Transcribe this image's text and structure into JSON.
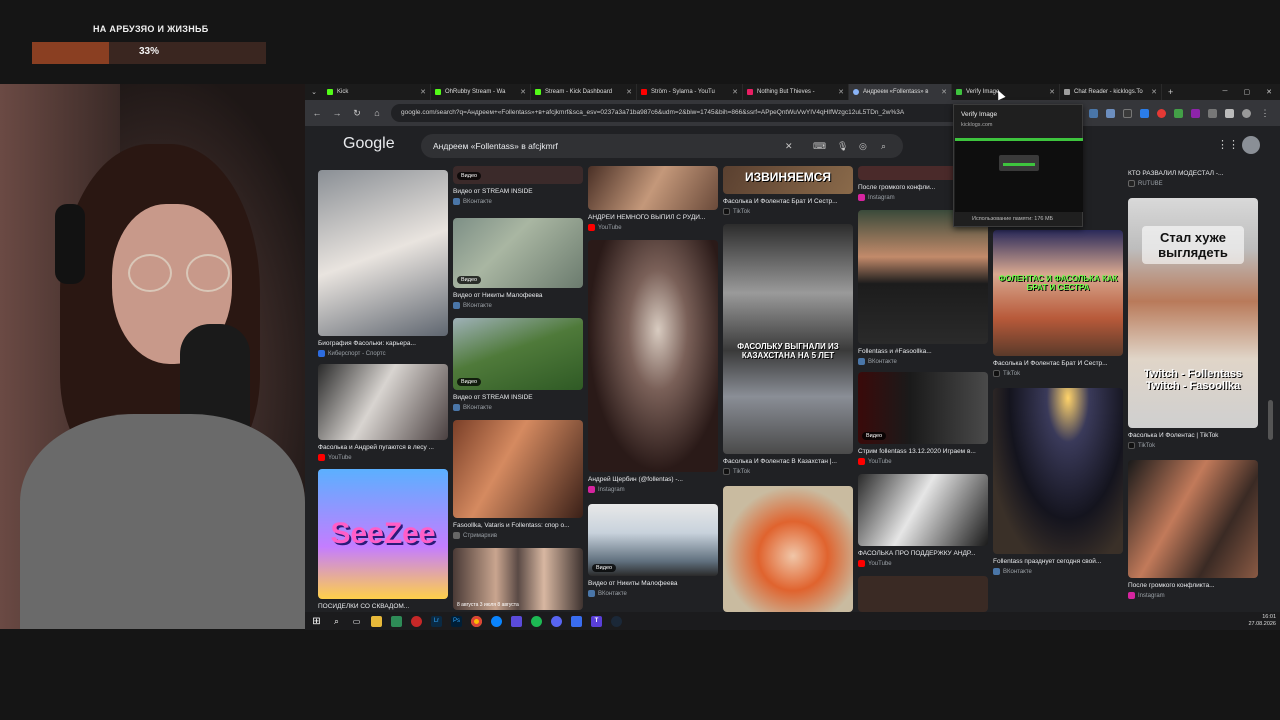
{
  "overlay": {
    "goal_title": "НА АРБУЗЯО И ЖИЗНЬБ",
    "goal_percent_text": "33%",
    "goal_progress": 0.33
  },
  "browser": {
    "tabs": [
      {
        "label": "Kick",
        "color": "#53fc18"
      },
      {
        "label": "OhRubby Stream - Wa",
        "color": "#53fc18"
      },
      {
        "label": "Stream - Kick Dashboard",
        "color": "#53fc18"
      },
      {
        "label": "Ström - Sylarna - YouTu",
        "color": "#ff0000"
      },
      {
        "label": "Nothing But Thieves -",
        "color": "#e91e63"
      },
      {
        "label": "Андреем «Follentass» в",
        "color": "#8ab4f8",
        "active": true
      },
      {
        "label": "Verify Image",
        "color": "#3ec43e"
      },
      {
        "label": "Chat Reader - kicklogs.To",
        "color": "#9e9e9e"
      }
    ],
    "url": "google.com/search?q=Андреем+«Follentass»+в+afcjkmrf&sca_esv=0237a3a71ba987c6&udm=2&biw=1745&bih=866&ssrf=APpeQntWuVwYIV4qHIfWzgc12uL5TDn_2w%3A",
    "popup": {
      "title": "Verify Image",
      "domain": "kicklogs.com",
      "memory": "Использование памяти: 176 МБ"
    }
  },
  "google": {
    "logo": "Google",
    "query": "Андреем «Follentass» в afcjkmrf"
  },
  "results": {
    "c1": [
      {
        "title": "Биография Фасольки: карьера...",
        "source": "Киберспорт - Спортс"
      },
      {
        "title": "Фасолька и Андрей пугаются в лесу ...",
        "source": "YouTube"
      },
      {
        "title": "ПОСИДЕЛКИ СО СКВАДОМ...",
        "source": ""
      }
    ],
    "c2": [
      {
        "title": "Видео от STREAM INSIDE",
        "source": "ВКонтакте",
        "badge": "Видео"
      },
      {
        "title": "Видео от Никиты Малофеева",
        "source": "ВКонтакте",
        "badge": "Видео"
      },
      {
        "title": "Видео от STREAM INSIDE",
        "source": "ВКонтакте",
        "badge": "Видео"
      },
      {
        "title": "Fasoollka, Vataris и Follentass: спор о...",
        "source": "Стримархив"
      },
      {
        "title": "",
        "source": "",
        "dates": "8 августа   3 июля   8 августа"
      }
    ],
    "c3": [
      {
        "title": "АНДРЕЙ НЕМНОГО ВЫПИЛ С РУДИ...",
        "source": "YouTube"
      },
      {
        "title": "Андрей Щербин (@follentas) -...",
        "source": "Instagram"
      },
      {
        "title": "Видео от Никиты Малофеева",
        "source": "ВКонтакте",
        "badge": "Видео"
      }
    ],
    "c4": [
      {
        "title": "Фасолька И Фолентас Брат И Сестр...",
        "source": "TikTok",
        "overlay": "ИЗВИНЯЕМСЯ"
      },
      {
        "title": "Фасолька И Фолентас В Казахстан |...",
        "source": "TikTok",
        "overlay": "ФАСОЛЬКУ ВЫГНАЛИ ИЗ КАЗАХСТАНА НА 5 ЛЕТ"
      },
      {
        "title": "",
        "source": ""
      }
    ],
    "c5": [
      {
        "title": "После громкого конфли...",
        "source": "Instagram"
      },
      {
        "title": "Follentass и #Fasoollka...",
        "source": "ВКонтакте"
      },
      {
        "title": "Стрим follentass 13.12.2020 Играем в...",
        "source": "YouTube",
        "badge": "Видео"
      },
      {
        "title": "ФАСОЛЬКА ПРО ПОДДЕРЖКУ АНДР...",
        "source": "YouTube"
      }
    ],
    "c6": [
      {
        "title": "Фасолька И Фолентас Брат И Сестр...",
        "source": "TikTok",
        "overlay": "ФОЛЕНТАС И ФАСОЛЬКА КАК БРАТ И СЕСТРА"
      },
      {
        "title": "Follentass празднует сегодня свой...",
        "source": "ВКонтакте"
      }
    ],
    "c7": [
      {
        "title": "КТО РАЗВАЛИЛ МОДЕСТАЛ -...",
        "source": "RUTUBE"
      },
      {
        "title": "Фасолька И Фолентас | TikTok",
        "source": "TikTok",
        "overlay_top": "Стал хуже выглядеть",
        "overlay_bottom": "Twitch - Follentass Twitch - Fasoollka"
      },
      {
        "title": "После громкого конфликта...",
        "source": "Instagram"
      }
    ]
  },
  "taskbar": {
    "time": "16:01",
    "date": "27.08.2026"
  },
  "colors": {
    "accent_green": "#3ec43e",
    "goal_fill": "#8a3f22",
    "google_bg": "#202124"
  }
}
